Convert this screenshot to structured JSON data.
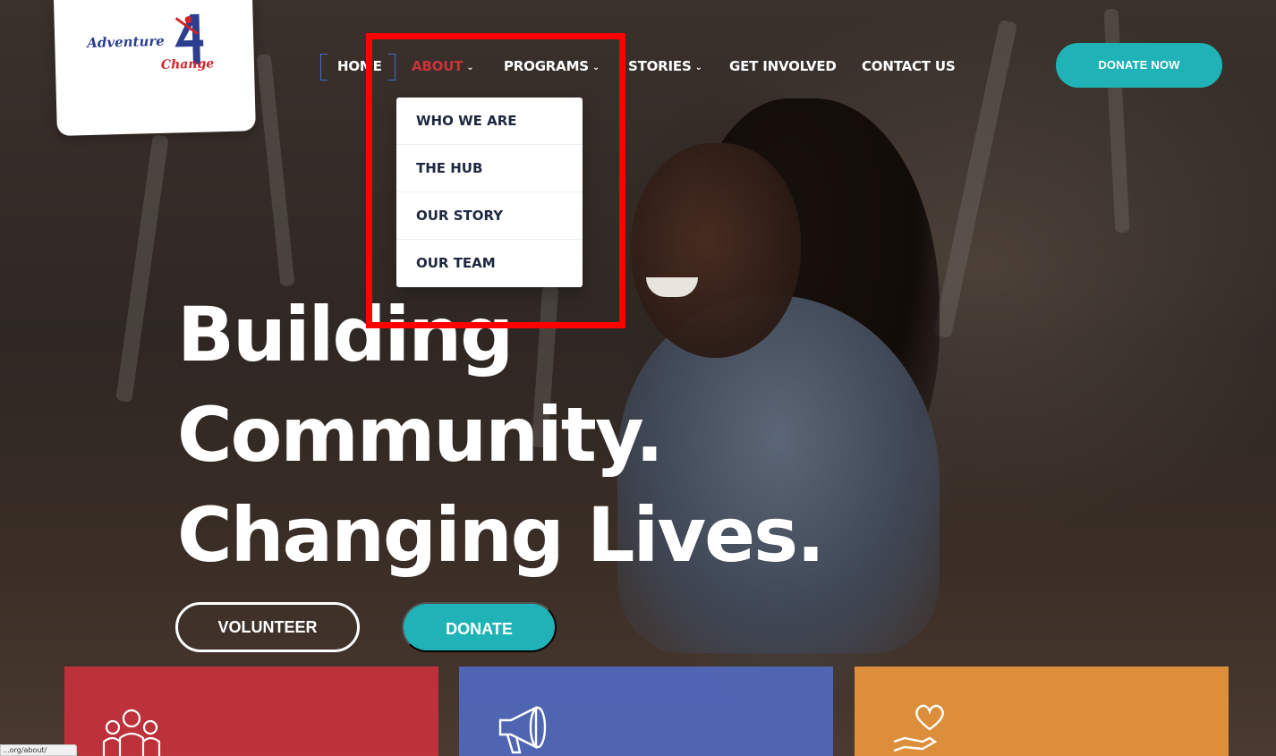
{
  "logo": {
    "line1": "Adventure",
    "line2": "Change",
    "alt_mark": "4"
  },
  "nav": {
    "items": [
      {
        "label": "HOME",
        "has_dropdown": false
      },
      {
        "label": "ABOUT",
        "has_dropdown": true,
        "active": true
      },
      {
        "label": "PROGRAMS",
        "has_dropdown": true
      },
      {
        "label": "STORIES",
        "has_dropdown": true
      },
      {
        "label": "GET INVOLVED",
        "has_dropdown": false
      },
      {
        "label": "CONTACT US",
        "has_dropdown": false
      }
    ],
    "donate_label": "DONATE NOW"
  },
  "dropdown": {
    "items": [
      "WHO WE ARE",
      "THE HUB",
      "OUR STORY",
      "OUR TEAM"
    ]
  },
  "hero": {
    "headline": [
      "Building",
      "Community.",
      "Changing Lives."
    ],
    "volunteer_label": "VOLUNTEER",
    "donate_label": "DONATE"
  },
  "cards": [
    {
      "icon": "people-group-icon",
      "color": "#c8323c"
    },
    {
      "icon": "megaphone-icon",
      "color": "#5067b9"
    },
    {
      "icon": "heart-hand-icon",
      "color": "#ea963c"
    }
  ],
  "status_bar": {
    "url": "...org/about/"
  },
  "colors": {
    "accent_teal": "#1fb3b7",
    "active_red": "#c8343a",
    "highlight": "#ff0000",
    "nav_text": "#ffffff",
    "dropdown_text": "#1f2740"
  }
}
